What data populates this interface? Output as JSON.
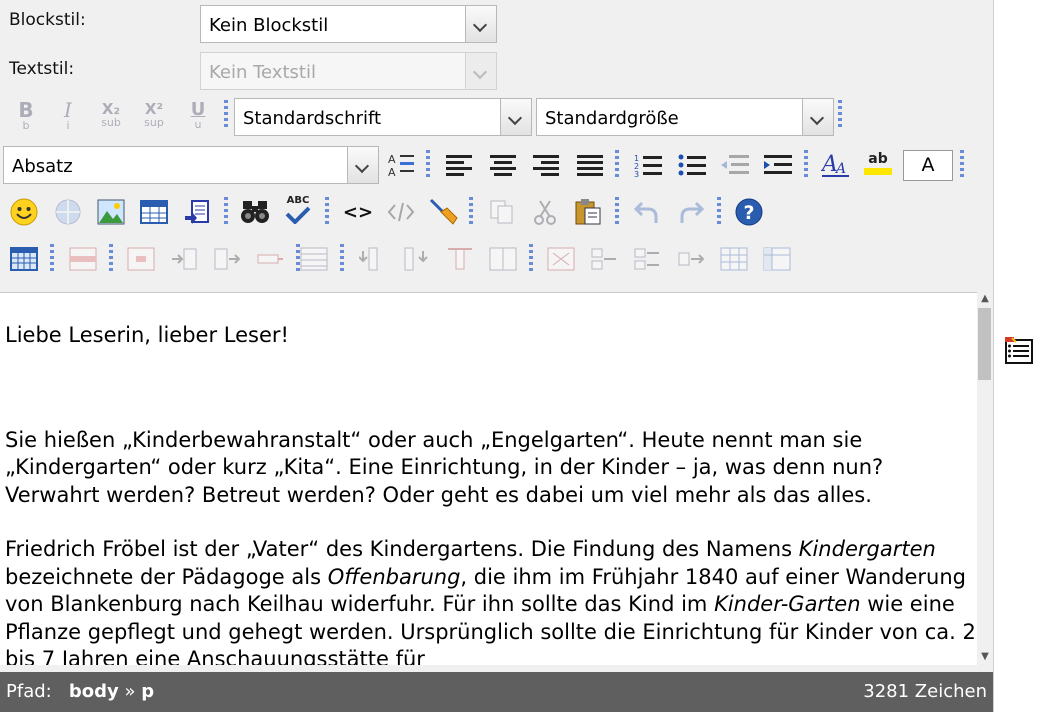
{
  "toolbar": {
    "blockstyle": {
      "label": "Blockstil:",
      "value": "Kein Blockstil"
    },
    "textstyle": {
      "label": "Textstil:",
      "value": "Kein Textstil"
    },
    "font": {
      "value": "Standardschrift"
    },
    "size": {
      "value": "Standardgröße"
    },
    "format": {
      "value": "Absatz"
    },
    "color_letter": "A",
    "icons": {
      "bold": "B",
      "bold_sub": "b",
      "italic": "I",
      "italic_sub": "i",
      "subscript": "X₂",
      "subscript_sub": "sub",
      "superscript": "X²",
      "superscript_sub": "sup",
      "underline": "U",
      "underline_sub": "u",
      "spellcheck": "ABC",
      "highlight": "ab",
      "code": "<>"
    }
  },
  "content": {
    "paragraphs": [
      "Liebe Leserin, lieber Leser!",
      "",
      "Sie hießen „Kinderbewahranstalt“ oder  auch „Engelgarten“. Heute nennt man sie „Kindergarten“ oder kurz „Kita“. Eine Einrichtung, in der Kinder – ja, was denn nun? Verwahrt werden? Betreut werden? Oder geht es dabei um viel mehr als das alles."
    ],
    "p4": {
      "s1": "Friedrich Fröbel ist der „Vater“ des Kindergartens. Die Findung des Namens ",
      "i1": "Kindergarten",
      "s2": " bezeichnete der Pädagoge als ",
      "i2": "Offenbarung",
      "s3": ", die ihm im Frühjahr 1840 auf einer Wanderung von Blankenburg nach Keilhau widerfuhr. Für ihn sollte das Kind im ",
      "i3": "Kinder-Garten",
      "s4": " wie eine Pflanze gepflegt und gehegt werden. Ursprünglich sollte die Einrichtung für Kinder von ca. 2 bis 7 Jahren eine Anschauungsstätte für"
    }
  },
  "status": {
    "path_label": "Pfad:",
    "path_body": "body",
    "path_sep": "»",
    "path_p": "p",
    "char_count": "3281 Zeichen"
  }
}
